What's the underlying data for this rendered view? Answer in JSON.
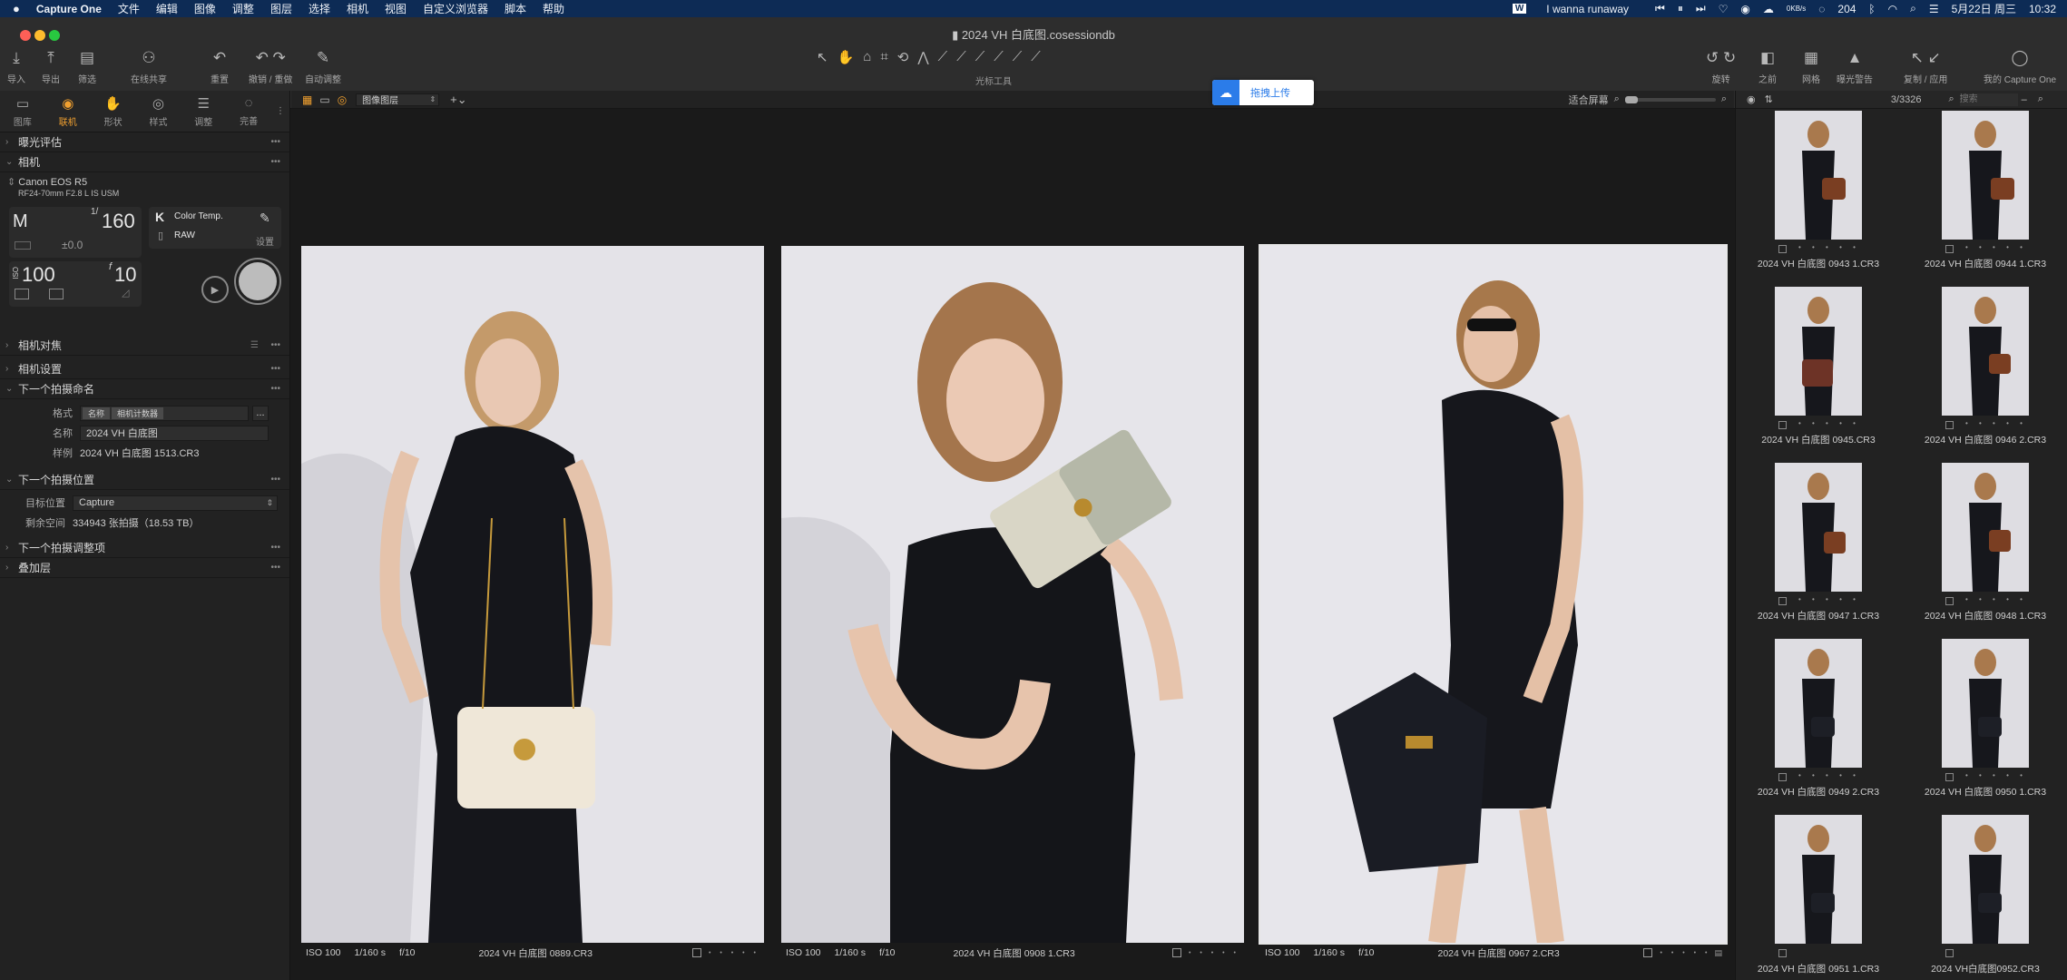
{
  "menubar": {
    "apple": "",
    "app_name": "Capture One",
    "items": [
      "文件",
      "编辑",
      "图像",
      "调整",
      "图层",
      "选择",
      "相机",
      "视图",
      "自定义浏览器",
      "脚本",
      "帮助"
    ],
    "right": {
      "song": "I wanna runaway",
      "net": "0KB/s",
      "count": "204",
      "date": "5月22日 周三",
      "time": "10:32"
    }
  },
  "window": {
    "title": "2024 VH 白底图.cosessiondb"
  },
  "toolbar_left": [
    {
      "label": "导入",
      "icon": "import-icon",
      "glyph": "⤓"
    },
    {
      "label": "导出",
      "icon": "export-icon",
      "glyph": "⤒"
    },
    {
      "label": "筛选",
      "icon": "filter-icon",
      "glyph": "▤"
    },
    {
      "label": "在线共享",
      "icon": "share-icon",
      "glyph": "⚇"
    },
    {
      "label": "重置",
      "icon": "reset-icon",
      "glyph": "↶"
    },
    {
      "label": "撤销 / 重做",
      "icon": "undo-redo-icon",
      "glyph": "↶ ↷"
    },
    {
      "label": "自动调整",
      "icon": "auto-adjust-icon",
      "glyph": "✎"
    }
  ],
  "toolbar_center_label": "光标工具",
  "toolbar_right": [
    {
      "label": "旋转",
      "icon": "rotate-icon",
      "glyph": "↺ ↻"
    },
    {
      "label": "之前",
      "icon": "before-icon",
      "glyph": "◧"
    },
    {
      "label": "网格",
      "icon": "grid-icon",
      "glyph": "▦"
    },
    {
      "label": "曝光警告",
      "icon": "exposure-warning-icon",
      "glyph": "▲"
    },
    {
      "label": "复制 / 应用",
      "icon": "copy-apply-icon",
      "glyph": "↖ ↙"
    },
    {
      "label": "我的 Capture One",
      "icon": "account-icon",
      "glyph": "◯"
    }
  ],
  "tool_tabs": [
    {
      "label": "图库",
      "icon": "library-icon",
      "glyph": "▭"
    },
    {
      "label": "联机",
      "icon": "tether-icon",
      "glyph": "◉",
      "active": true
    },
    {
      "label": "形状",
      "icon": "shape-icon",
      "glyph": "✋"
    },
    {
      "label": "样式",
      "icon": "style-icon",
      "glyph": "◎"
    },
    {
      "label": "调整",
      "icon": "adjust-icon",
      "glyph": "☰"
    },
    {
      "label": "完善",
      "icon": "refine-icon",
      "glyph": "◌"
    }
  ],
  "sections": {
    "exposure": "曝光评估",
    "camera": "相机",
    "focus": "相机对焦",
    "settings": "相机设置",
    "naming": "下一个拍摄命名",
    "location": "下一个拍摄位置",
    "adjustments": "下一个拍摄调整项",
    "overlay": "叠加层"
  },
  "camera": {
    "model": "Canon EOS R5",
    "lens": "RF24-70mm F2.8 L IS USM",
    "mode": "M",
    "shutter_num": "1/",
    "shutter": "160",
    "ev": "±0.0",
    "iso_label": "ISO",
    "iso": "100",
    "aperture_f": "f",
    "aperture": "10",
    "wb_icon": "K",
    "wb": "Color Temp.",
    "format": "RAW",
    "settings_label": "设置"
  },
  "naming": {
    "format_label": "格式",
    "format_token1": "名称",
    "format_token2": "相机计数器",
    "name_label": "名称",
    "name_value": "2024 VH 白底图",
    "sample_label": "样例",
    "sample_value": "2024 VH 白底图 1513.CR3",
    "more": "..."
  },
  "location": {
    "target_label": "目标位置",
    "target_value": "Capture",
    "space_label": "剩余空间",
    "space_value": "334943 张拍摄（18.53 TB）"
  },
  "viewer": {
    "layer_select": "图像图层",
    "fit": "适合屏幕",
    "photos": [
      {
        "iso": "ISO 100",
        "shutter": "1/160 s",
        "aperture": "f/10",
        "name": "2024 VH 白底图 0889.CR3"
      },
      {
        "iso": "ISO 100",
        "shutter": "1/160 s",
        "aperture": "f/10",
        "name": "2024 VH 白底图 0908 1.CR3"
      },
      {
        "iso": "ISO 100",
        "shutter": "1/160 s",
        "aperture": "f/10",
        "name": "2024 VH 白底图 0967 2.CR3"
      }
    ],
    "dots": "• • • • •"
  },
  "upload": {
    "label": "拖拽上传"
  },
  "browser": {
    "counter": "3/3326",
    "search_placeholder": "搜索",
    "thumbs": [
      "2024 VH 白底图 0943 1.CR3",
      "2024 VH 白底图 0944 1.CR3",
      "2024 VH 白底图 0945.CR3",
      "2024 VH 白底图 0946 2.CR3",
      "2024 VH 白底图 0947 1.CR3",
      "2024 VH 白底图 0948 1.CR3",
      "2024 VH 白底图 0949 2.CR3",
      "2024 VH 白底图 0950 1.CR3",
      "2024 VH 白底图 0951 1.CR3",
      "2024 VH白底图0952.CR3"
    ]
  },
  "colors": {
    "accent": "#f0a030",
    "menubar": "#0d2b55",
    "upload_blue": "#2b7ce9"
  }
}
